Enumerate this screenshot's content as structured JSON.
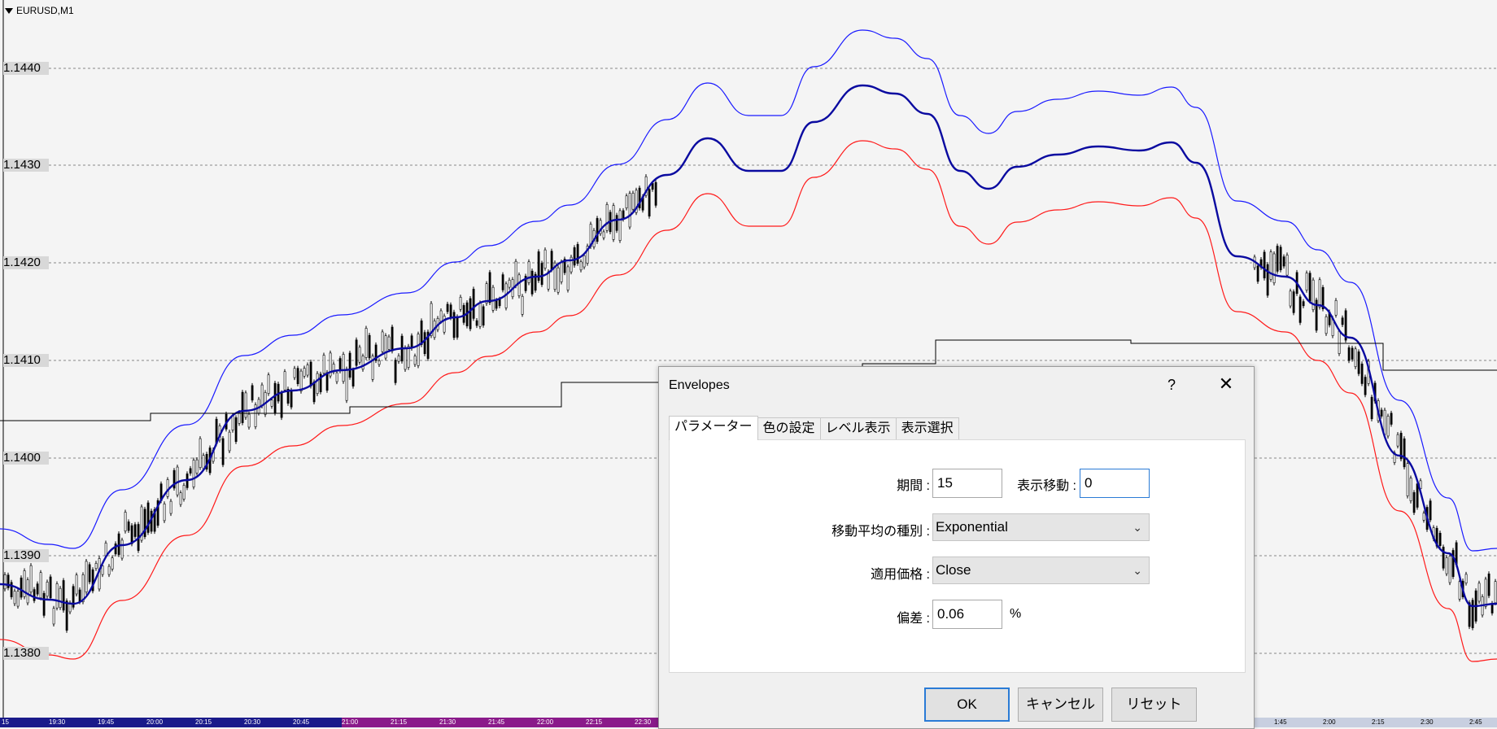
{
  "chart": {
    "symbol": "EURUSD,M1",
    "price_labels": [
      "1.1440",
      "1.1430",
      "1.1420",
      "1.1410",
      "1.1400",
      "1.1390",
      "1.1380"
    ],
    "time_labels": [
      "15",
      "19:30",
      "19:45",
      "20:00",
      "20:15",
      "20:30",
      "20:45",
      "21:00",
      "21:15",
      "21:30",
      "21:45",
      "22:00",
      "22:15",
      "22:30",
      "1:45",
      "2:00",
      "2:15",
      "2:30",
      "2:45"
    ],
    "colors": {
      "upper": "#1a1aff",
      "lower": "#ff1a1a",
      "ma_up": "#0a0aa0",
      "ma_down": "#d0102a",
      "candle": "#000000",
      "grid": "#888888"
    }
  },
  "dialog": {
    "title": "Envelopes",
    "help": "?",
    "close": "✕",
    "tabs": [
      "パラメーター",
      "色の設定",
      "レベル表示",
      "表示選択"
    ],
    "fields": {
      "period_label": "期間 :",
      "period_value": "15",
      "shift_label": "表示移動 :",
      "shift_value": "0",
      "ma_method_label": "移動平均の種別 :",
      "ma_method_value": "Exponential",
      "price_label": "適用価格 :",
      "price_value": "Close",
      "deviation_label": "偏差 :",
      "deviation_value": "0.06",
      "deviation_unit": "%"
    },
    "buttons": {
      "ok": "OK",
      "cancel": "キャンセル",
      "reset": "リセット"
    }
  }
}
